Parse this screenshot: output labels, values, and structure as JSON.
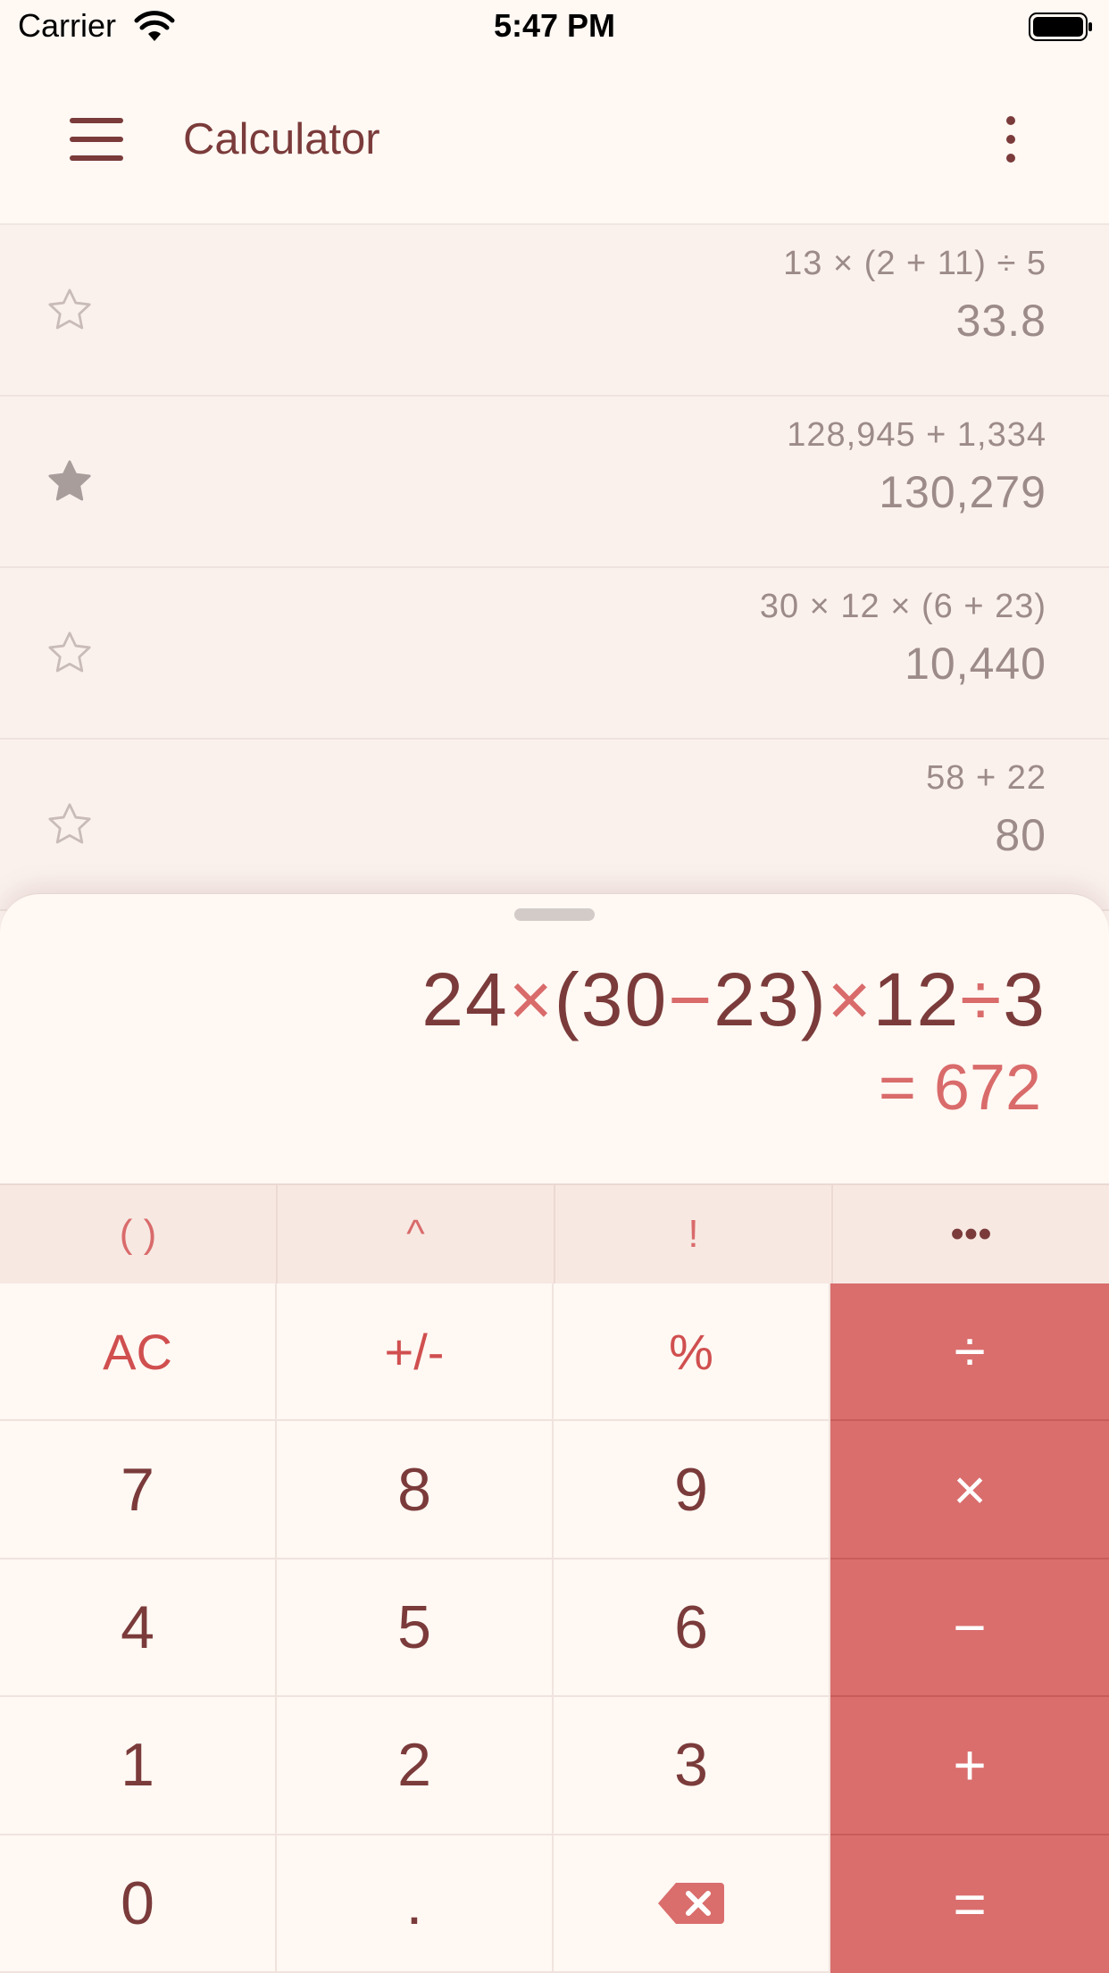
{
  "status_bar": {
    "carrier": "Carrier",
    "time": "5:47 PM"
  },
  "app_bar": {
    "title": "Calculator"
  },
  "history": [
    {
      "expression": "13 × (2 + 11) ÷ 5",
      "result": "33.8",
      "starred": false
    },
    {
      "expression": "128,945 + 1,334",
      "result": "130,279",
      "starred": true
    },
    {
      "expression": "30 × 12 × (6 + 23)",
      "result": "10,440",
      "starred": false
    },
    {
      "expression": "58 + 22",
      "result": "80",
      "starred": false
    }
  ],
  "display": {
    "expression_tokens": [
      {
        "t": "24",
        "op": false
      },
      {
        "t": "×",
        "op": true
      },
      {
        "t": "(30",
        "op": false
      },
      {
        "t": "−",
        "op": true
      },
      {
        "t": "23)",
        "op": false
      },
      {
        "t": "×",
        "op": true
      },
      {
        "t": "12",
        "op": false
      },
      {
        "t": "÷",
        "op": true
      },
      {
        "t": "3",
        "op": false
      }
    ],
    "result": "= 672"
  },
  "function_row": [
    "( )",
    "^",
    "!",
    "•••"
  ],
  "keys": {
    "ac": "AC",
    "sign": "+/-",
    "percent": "%",
    "divide": "÷",
    "seven": "7",
    "eight": "8",
    "nine": "9",
    "multiply": "×",
    "four": "4",
    "five": "5",
    "six": "6",
    "minus": "−",
    "one": "1",
    "two": "2",
    "three": "3",
    "plus": "+",
    "zero": "0",
    "decimal": ".",
    "equals": "="
  },
  "colors": {
    "accent": "#d96e6d",
    "text": "#7a3b3a",
    "background": "#fff8f3",
    "history_bg": "#faf1ed"
  },
  "icons": {
    "menu": "hamburger-menu-icon",
    "more": "vertical-ellipsis-icon",
    "star_empty": "star-outline-icon",
    "star_filled": "star-filled-icon",
    "backspace": "backspace-icon"
  }
}
